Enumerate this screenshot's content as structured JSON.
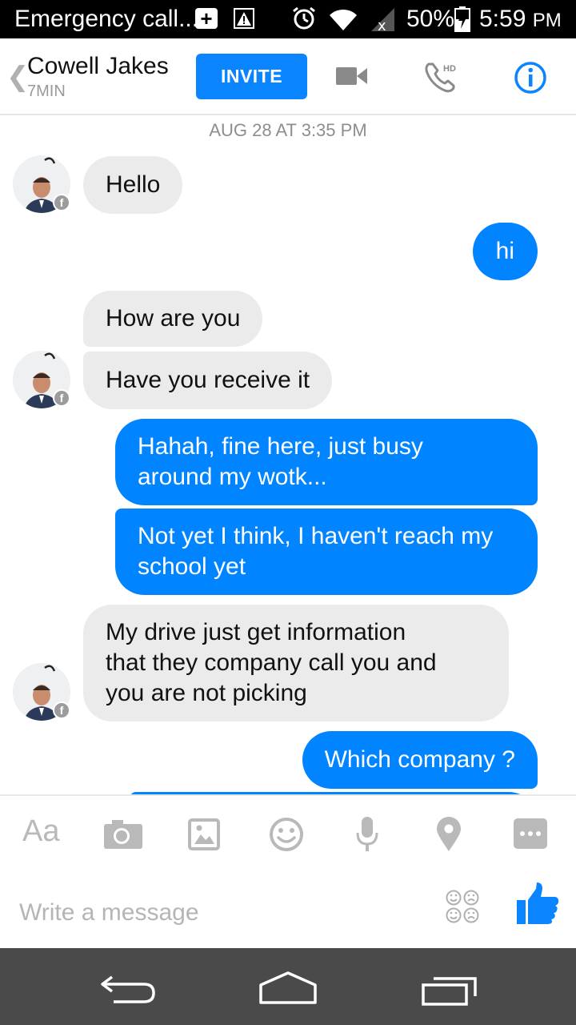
{
  "status_bar": {
    "notification_title": "Emergency call...",
    "battery_percent": "50%",
    "time": "5:59",
    "time_suffix": "PM"
  },
  "header": {
    "contact_name": "Cowell Jakes",
    "contact_status": "7MIN",
    "invite_label": "INVITE",
    "phone_badge": "HD",
    "accent_color": "#0a84ff"
  },
  "conversation": {
    "timestamp": "AUG 28 AT 3:35 PM",
    "messages": [
      {
        "direction": "incoming",
        "lines": [
          "Hello"
        ]
      },
      {
        "direction": "outgoing",
        "lines": [
          "hi"
        ]
      },
      {
        "direction": "incoming",
        "lines": [
          "How are you"
        ]
      },
      {
        "direction": "incoming",
        "lines": [
          "Have you receive it"
        ]
      },
      {
        "direction": "outgoing",
        "lines": [
          "Hahah, fine here, just busy",
          "around my wotk..."
        ]
      },
      {
        "direction": "outgoing",
        "lines": [
          "Not yet I think, I haven't reach my",
          "school yet"
        ]
      },
      {
        "direction": "incoming",
        "lines": [
          "My drive just get information",
          "that they company call you and",
          "you are not picking"
        ]
      },
      {
        "direction": "outgoing",
        "lines": [
          "Which company ?"
        ]
      }
    ],
    "incoming_color": "#ebebeb",
    "outgoing_color": "#0084ff"
  },
  "composer": {
    "text_tool_label": "Aa",
    "placeholder": "Write a message",
    "tools": [
      "text-icon",
      "camera-icon",
      "gallery-icon",
      "emoji-icon",
      "microphone-icon",
      "location-icon",
      "more-icon"
    ]
  },
  "nav": {
    "buttons": [
      "back-icon",
      "home-icon",
      "recent-apps-icon"
    ]
  }
}
